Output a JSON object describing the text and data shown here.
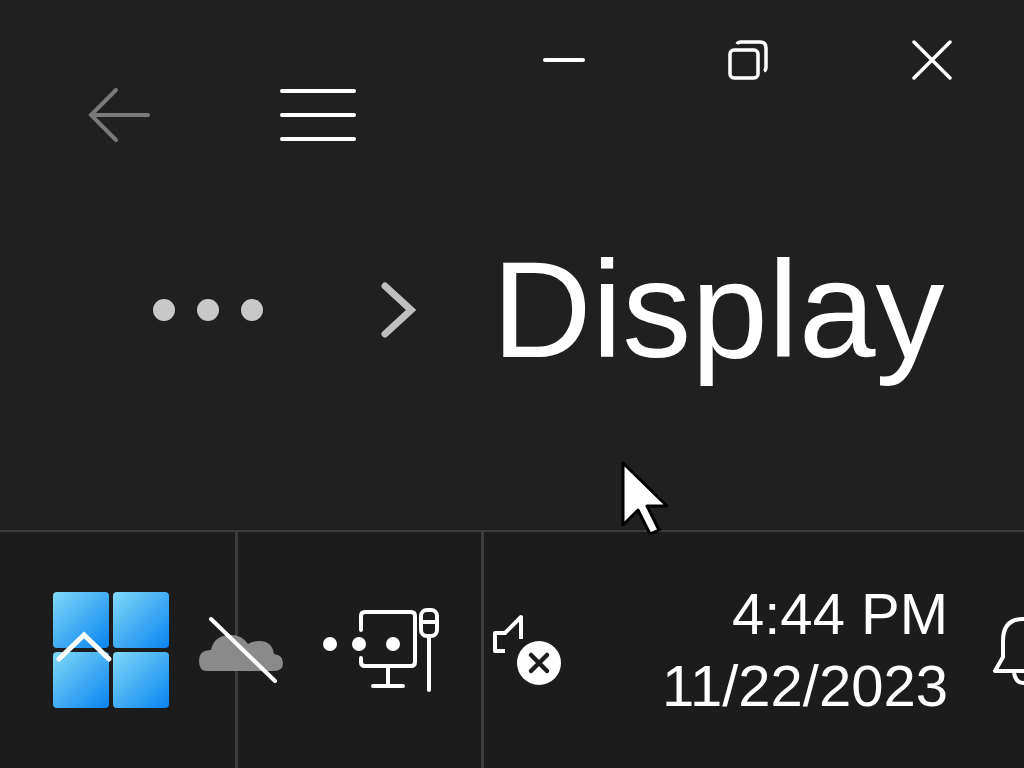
{
  "navigation": {
    "back_disabled": true
  },
  "page": {
    "title": "Display"
  },
  "taskbar": {
    "time": "4:44 PM",
    "date": "11/22/2023"
  }
}
